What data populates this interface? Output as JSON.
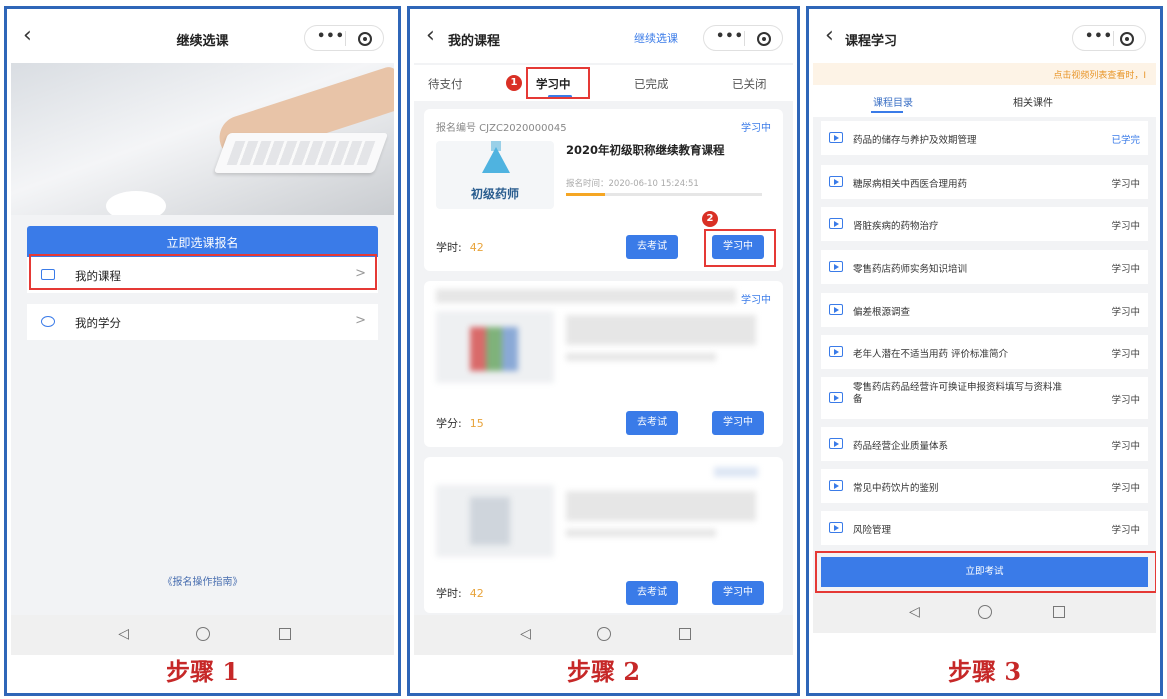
{
  "colors": {
    "accent": "#3a7be8",
    "frame": "#2f66b8",
    "highlight": "#e53935",
    "step": "#c62828",
    "hours": "#e8a33a"
  },
  "panel1": {
    "nav_title": "继续选课",
    "enroll_button": "立即选课报名",
    "my_courses": "我的课程",
    "my_credits": "我的学分",
    "guide": "《报名操作指南》",
    "step": "步骤 1"
  },
  "panel2": {
    "nav_title": "我的课程",
    "continue_link": "继续选课",
    "tabs": [
      "待支付",
      "学习中",
      "已完成",
      "已关闭"
    ],
    "markers": [
      "1",
      "2"
    ],
    "card1": {
      "order_no": "报名编号 CJZC2020000045",
      "status": "学习中",
      "thumb_label": "初级药师",
      "title": "2020年初级职称继续教育课程",
      "enroll_time": "报名时间：2020-06-10 15:24:51",
      "progress": 0.2,
      "hours_label": "学时:",
      "hours_value": "42",
      "exam_button": "去考试",
      "study_button": "学习中"
    },
    "card2": {
      "status": "学习中",
      "hours_label": "学分:",
      "hours_value": "15",
      "exam_button": "去考试",
      "study_button": "学习中"
    },
    "card3": {
      "hours_label": "学时:",
      "hours_value": "42",
      "exam_button": "去考试",
      "study_button": "学习中"
    },
    "step": "步骤 2"
  },
  "panel3": {
    "nav_title": "课程学习",
    "notice": "点击视频列表查看时，I",
    "tabs": [
      "课程目录",
      "相关课件"
    ],
    "lessons": [
      {
        "title": "药品的储存与养护及效期管理",
        "status": "已学完"
      },
      {
        "title": "糖尿病相关中西医合理用药",
        "status": "学习中"
      },
      {
        "title": "肾脏疾病的药物治疗",
        "status": "学习中"
      },
      {
        "title": "零售药店药师实务知识培训",
        "status": "学习中"
      },
      {
        "title": "偏差根源调查",
        "status": "学习中"
      },
      {
        "title": "老年人潜在不适当用药 评价标准简介",
        "status": "学习中"
      },
      {
        "title": "零售药店药品经营许可换证申报资料填写与资料准备",
        "status": "学习中"
      },
      {
        "title": "药品经营企业质量体系",
        "status": "学习中"
      },
      {
        "title": "常见中药饮片的鉴别",
        "status": "学习中"
      },
      {
        "title": "风险管理",
        "status": "学习中"
      }
    ],
    "exam_button": "立即考试",
    "step": "步骤 3"
  },
  "icons": {
    "back": "chevron-left-icon",
    "more": "more-dots-icon",
    "target": "target-icon",
    "book": "book-icon",
    "credit": "credit-icon",
    "play": "play-video-icon"
  }
}
